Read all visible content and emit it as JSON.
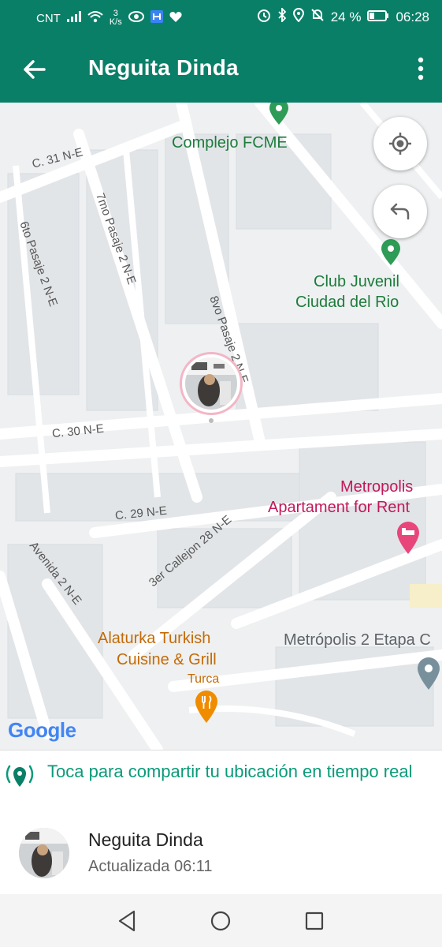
{
  "status_bar": {
    "carrier": "CNT",
    "speed_value": "3",
    "speed_unit": "K/s",
    "battery": "24 %",
    "time": "06:28"
  },
  "header": {
    "title": "Neguita Dinda"
  },
  "map": {
    "pois": {
      "complejo": "Complejo FCME",
      "club_line1": "Club Juvenil",
      "club_line2": "Ciudad del Rio",
      "metropolis_line1": "Metropolis",
      "metropolis_line2": "Apartament for Rent",
      "alaturka_line1": "Alaturka Turkish",
      "alaturka_line2": "Cuisine & Grill",
      "alaturka_sub": "Turca",
      "metropolis2": "Metrópolis 2 Etapa C"
    },
    "streets": {
      "c31": "C. 31 N-E",
      "sexto": "6to Pasaje 2 N-E",
      "septimo": "7mo Pasaje 2 N-E",
      "octavo": "8vo Pasaje 2 N-E",
      "c30": "C. 30 N-E",
      "c29": "C. 29 N-E",
      "callejon": "3er Callejon 28 N-E",
      "avenida": "Avenida 2 N-E"
    },
    "attribution": "Google"
  },
  "share": {
    "text": "Toca para compartir tu ubicación en tiempo real"
  },
  "contact": {
    "name": "Neguita Dinda",
    "updated": "Actualizada 06:11"
  },
  "colors": {
    "accent": "#0a7f68",
    "share_text": "#0a9a7a"
  }
}
